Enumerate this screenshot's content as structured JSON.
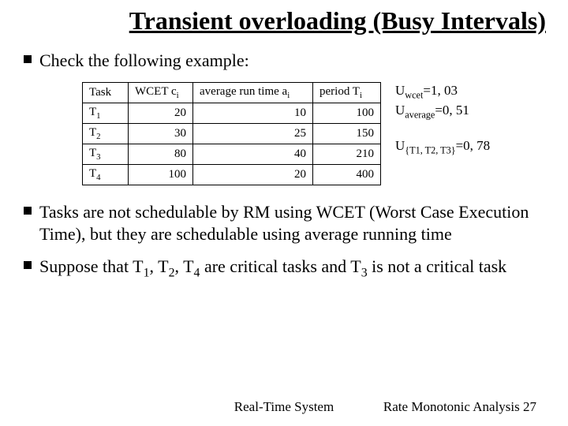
{
  "title": "Transient overloading (Busy Intervals)",
  "bullet1": "Check the following example:",
  "table": {
    "head": {
      "task": "Task",
      "wcet_pre": "WCET c",
      "avg_pre": "average run time a",
      "period_pre": "period T",
      "sub": "i"
    },
    "rows": [
      {
        "task_pre": "T",
        "task_sub": "1",
        "wcet": "20",
        "avg": "10",
        "period": "100"
      },
      {
        "task_pre": "T",
        "task_sub": "2",
        "wcet": "30",
        "avg": "25",
        "period": "150"
      },
      {
        "task_pre": "T",
        "task_sub": "3",
        "wcet": "80",
        "avg": "40",
        "period": "210"
      },
      {
        "task_pre": "T",
        "task_sub": "4",
        "wcet": "100",
        "avg": "20",
        "period": "400"
      }
    ]
  },
  "side": {
    "u_wcet_label": "U",
    "u_wcet_sub": "wcet",
    "u_wcet_val": "=1, 03",
    "u_avg_label": "U",
    "u_avg_sub": "average",
    "u_avg_val": "=0, 51",
    "u_set_label": "U",
    "u_set_sub": "{T1, T2, T3}",
    "u_set_val": "=0, 78"
  },
  "bullet2_pre": "Tasks are not schedulable by RM using WCET (Worst Case Execution Time), but they are schedulable using average running time",
  "bullet3": {
    "pre": "Suppose that T",
    "mid1": ", T",
    "mid2": ", T",
    "mid3": " are critical tasks and T",
    "tail": " is not a critical task",
    "s1": "1",
    "s2": "2",
    "s4": "4",
    "s3": "3"
  },
  "footer_center": "Real-Time System",
  "footer_right_pre": "Rate Monotonic Analysis ",
  "footer_right_num": "27",
  "chart_data": {
    "type": "table",
    "columns": [
      "Task",
      "WCET c_i",
      "average run time a_i",
      "period T_i"
    ],
    "rows": [
      [
        "T1",
        20,
        10,
        100
      ],
      [
        "T2",
        30,
        25,
        150
      ],
      [
        "T3",
        80,
        40,
        210
      ],
      [
        "T4",
        100,
        20,
        400
      ]
    ],
    "annotations": {
      "U_wcet": 1.03,
      "U_average": 0.51,
      "U_{T1,T2,T3}": 0.78
    }
  }
}
